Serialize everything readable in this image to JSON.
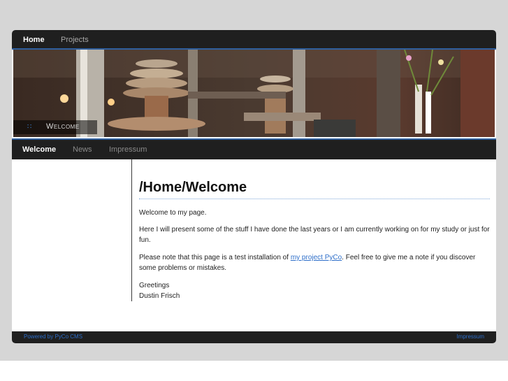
{
  "top_nav": {
    "items": [
      "Home",
      "Projects"
    ],
    "active": "Home"
  },
  "banner": {
    "title": "Welcome"
  },
  "sub_nav": {
    "items": [
      "Welcome",
      "News",
      "Impressum"
    ],
    "active": "Welcome"
  },
  "content": {
    "heading": "/Home/Welcome",
    "p1": "Welcome to my page.",
    "p2": "Here I will present some of the stuff I have done the last years or I am currently working on for my study or just for fun.",
    "p3_before": "Please note that this page is a test installation of ",
    "p3_link": "my project PyCo",
    "p3_after": ". Feel free to give me a note if you discover some problems or mistakes.",
    "greeting": "Greetings",
    "signature": "Dustin Frisch"
  },
  "footer": {
    "left": "Powered by PyCo CMS",
    "right": "Impressum"
  },
  "colors": {
    "accent": "#2d6ec9",
    "nav_bg": "#1f1f1f",
    "nav_line": "#2f5f9e"
  }
}
